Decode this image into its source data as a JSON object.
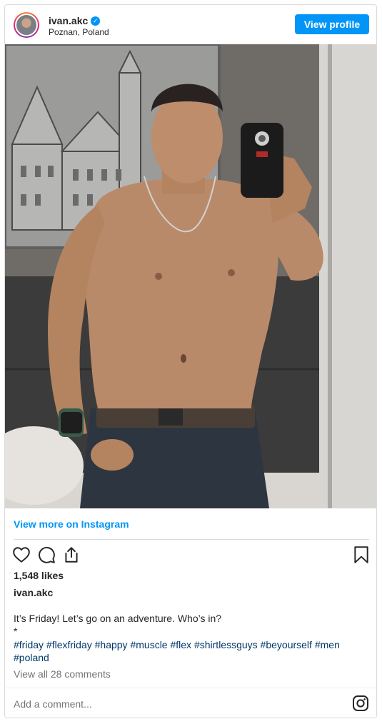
{
  "header": {
    "username": "ivan.akc",
    "verified_mark": "✓",
    "location": "Poznan, Poland",
    "view_profile_label": "View profile"
  },
  "post": {
    "image_alt": "Shirtless mirror selfie of a man holding a phone in a hotel room",
    "view_more_label": "View more on Instagram",
    "likes": "1,548 likes",
    "author": "ivan.akc",
    "caption": "It’s Friday! Let’s go on an adventure. Who’s in?",
    "caption_separator": "*",
    "hashtags": [
      "#friday",
      "#flexfriday",
      "#happy",
      "#muscle",
      "#flex",
      "#shirtlessguys",
      "#beyourself",
      "#men",
      "#poland"
    ],
    "view_comments_label": "View all 28 comments",
    "add_comment_placeholder": "Add a comment..."
  },
  "icons": {
    "verified": "verified-badge-icon",
    "like": "heart-icon",
    "comment": "comment-icon",
    "share": "share-icon",
    "save": "bookmark-icon",
    "brand": "instagram-icon"
  },
  "colors": {
    "accent": "#0095f6",
    "hashtag": "#00376b",
    "secondary_text": "#737373",
    "border": "#dbdbdb"
  }
}
